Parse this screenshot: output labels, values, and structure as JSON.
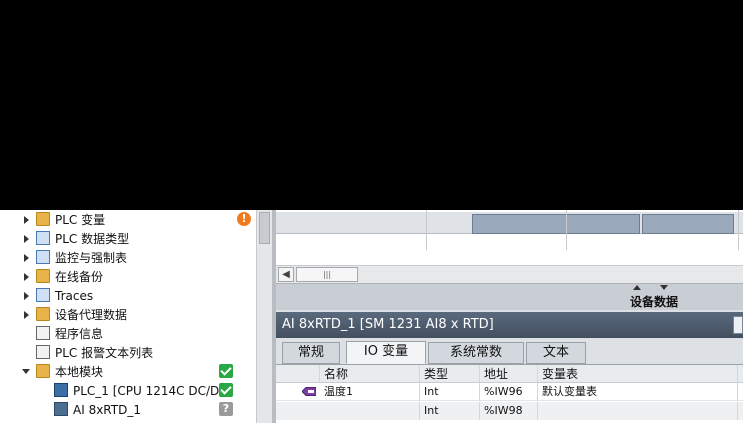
{
  "tree": {
    "items": [
      {
        "label": "PLC 变量",
        "expand": "collapsed",
        "icon": "plc-tags-folder-icon",
        "status": "warn",
        "status_text": "!"
      },
      {
        "label": "PLC 数据类型",
        "expand": "collapsed",
        "icon": "plc-datatypes-folder-icon"
      },
      {
        "label": "监控与强制表",
        "expand": "collapsed",
        "icon": "watch-force-tables-folder-icon"
      },
      {
        "label": "在线备份",
        "expand": "collapsed",
        "icon": "online-backups-folder-icon"
      },
      {
        "label": "Traces",
        "expand": "collapsed",
        "icon": "traces-folder-icon"
      },
      {
        "label": "设备代理数据",
        "expand": "collapsed",
        "icon": "device-proxy-data-folder-icon"
      },
      {
        "label": "程序信息",
        "expand": "none",
        "icon": "program-info-icon"
      },
      {
        "label": "PLC 报警文本列表",
        "expand": "none",
        "icon": "alarm-text-list-icon"
      },
      {
        "label": "本地模块",
        "expand": "expanded",
        "icon": "local-modules-folder-icon",
        "status": "ok"
      },
      {
        "label": "PLC_1 [CPU 1214C DC/D...",
        "expand": "none",
        "icon": "cpu-icon",
        "status": "ok"
      },
      {
        "label": "AI 8xRTD_1",
        "expand": "none",
        "icon": "module-icon",
        "status": "unknown",
        "status_text": "?"
      }
    ]
  },
  "device_view": {
    "scroll_thumb_glyph": "|||",
    "panel_label": "设备数据"
  },
  "inspector": {
    "title": "AI 8xRTD_1 [SM 1231 AI8 x RTD]",
    "tabs": [
      {
        "label": "常规",
        "active": false
      },
      {
        "label": "IO 变量",
        "active": true
      },
      {
        "label": "系统常数",
        "active": false
      },
      {
        "label": "文本",
        "active": false
      }
    ],
    "columns": [
      "名称",
      "类型",
      "地址",
      "变量表"
    ],
    "rows": [
      {
        "name": "温度1",
        "type": "Int",
        "address": "%IW96",
        "table": "默认变量表"
      },
      {
        "name": "",
        "type": "Int",
        "address": "%IW98",
        "table": ""
      }
    ]
  },
  "colors": {
    "header_bg": "#4b5a6b",
    "ok": "#2aa845",
    "warn": "#f07a1e"
  }
}
